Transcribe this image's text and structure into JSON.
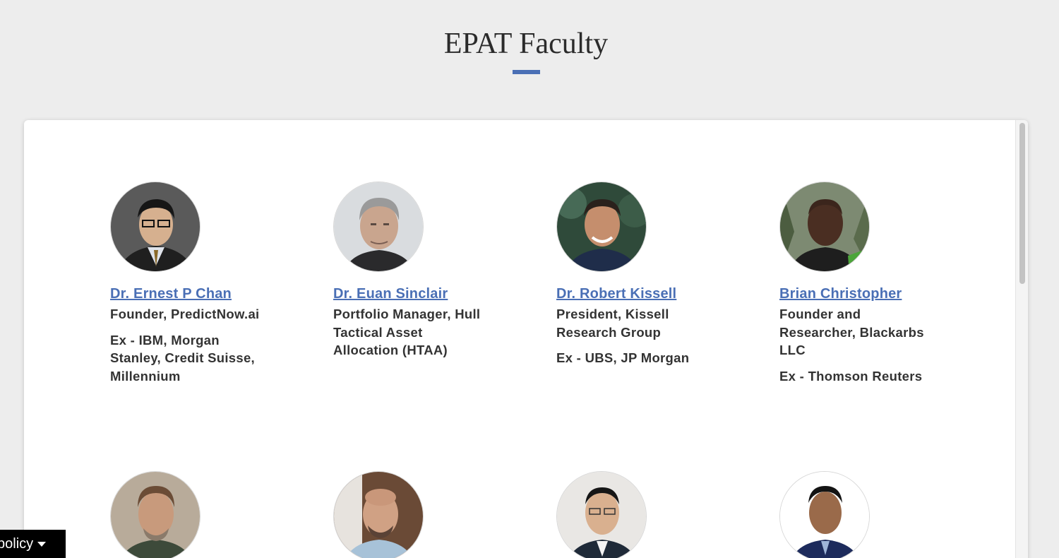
{
  "section": {
    "title": "EPAT Faculty",
    "accent_color": "#4a6fb5"
  },
  "faculty": [
    {
      "name": "Dr. Ernest P Chan",
      "role": "Founder, PredictNow.ai",
      "ex": "Ex - IBM, Morgan Stanley, Credit Suisse, Millennium",
      "photo": "portrait-photo"
    },
    {
      "name": "Dr. Euan Sinclair",
      "role": "Portfolio Manager, Hull Tactical Asset Allocation (HTAA)",
      "ex": "",
      "photo": "portrait-photo"
    },
    {
      "name": "Dr. Robert Kissell",
      "role": "President, Kissell Research Group",
      "ex": "Ex - UBS, JP Morgan",
      "photo": "portrait-photo"
    },
    {
      "name": "Brian Christopher",
      "role": "Founder and Researcher, Blackarbs LLC",
      "ex": "Ex - Thomson Reuters",
      "photo": "portrait-photo"
    },
    {
      "name": "",
      "role": "",
      "ex": "",
      "photo": "portrait-photo"
    },
    {
      "name": "",
      "role": "",
      "ex": "",
      "photo": "portrait-photo"
    },
    {
      "name": "",
      "role": "",
      "ex": "",
      "photo": "portrait-photo"
    },
    {
      "name": "",
      "role": "",
      "ex": "",
      "photo": "portrait-photo"
    }
  ],
  "cookie_policy": {
    "label": "policy",
    "icon": "caret-down-icon"
  }
}
